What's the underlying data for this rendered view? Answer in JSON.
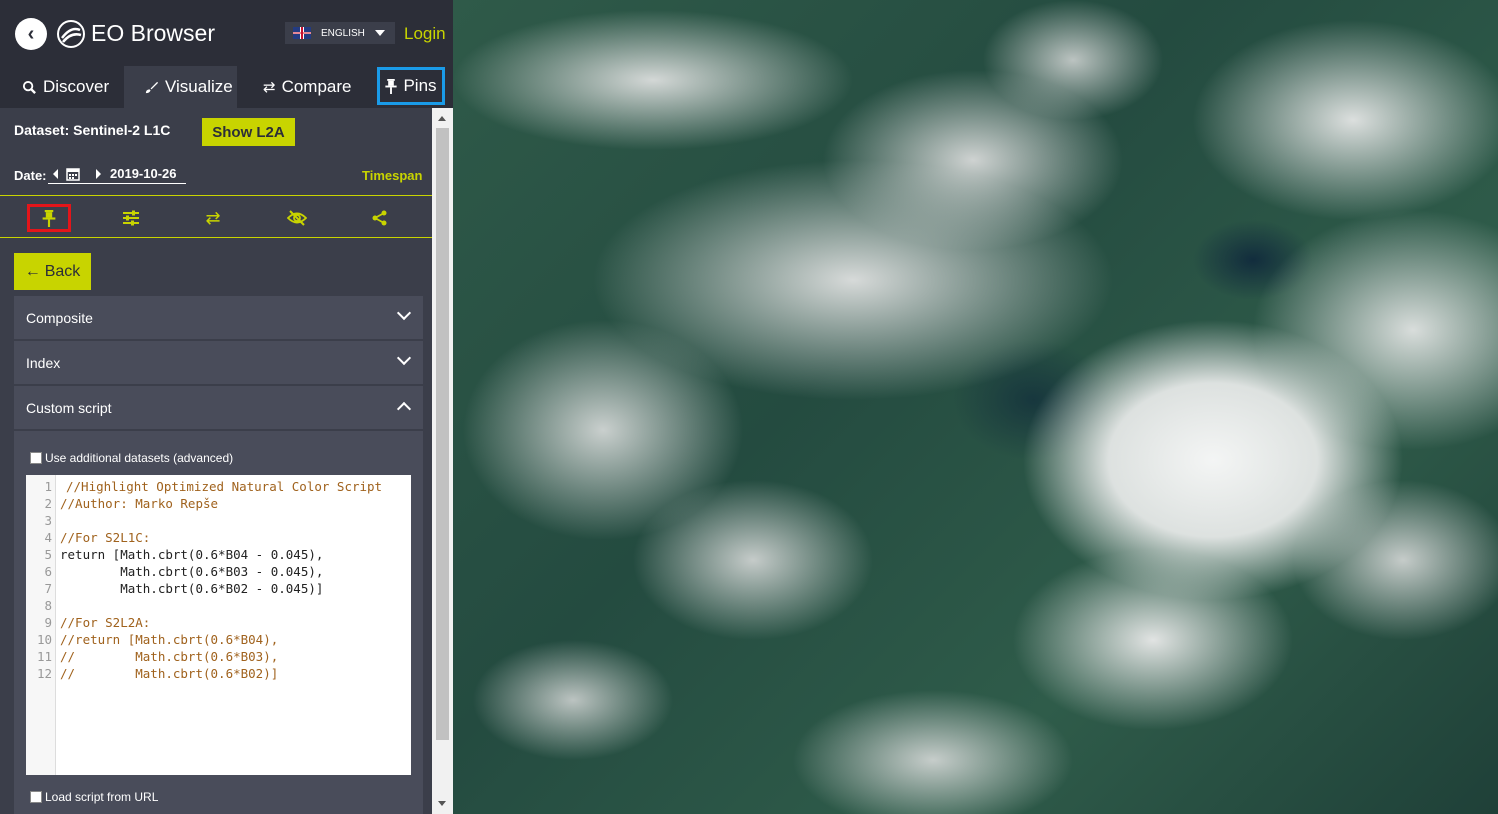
{
  "header": {
    "app_title": "EO Browser",
    "language": "ENGLISH",
    "login": "Login"
  },
  "tabs": [
    {
      "label": "Discover",
      "icon": "search-icon"
    },
    {
      "label": "Visualize",
      "icon": "brush-icon",
      "active": true
    },
    {
      "label": "Compare",
      "icon": "compare-arrows-icon"
    },
    {
      "label": "Pins",
      "icon": "pin-icon",
      "highlighted": true
    }
  ],
  "dataset": {
    "label": "Dataset:",
    "name": "Sentinel-2 L1C",
    "toggle_button": "Show L2A"
  },
  "date": {
    "label": "Date:",
    "value": "2019-10-26",
    "timespan": "Timespan"
  },
  "toolbar": [
    {
      "icon": "pin-icon",
      "highlighted": true
    },
    {
      "icon": "sliders-icon"
    },
    {
      "icon": "compare-arrows-icon"
    },
    {
      "icon": "eye-slash-icon"
    },
    {
      "icon": "share-icon"
    }
  ],
  "back_button": "Back",
  "accordion": {
    "composite": "Composite",
    "index": "Index",
    "custom_script": "Custom script"
  },
  "custom_script": {
    "additional_datasets": "Use additional datasets (advanced)",
    "load_from_url": "Load script from URL",
    "lines": [
      "//Highlight Optimized Natural Color Script",
      "//Author: Marko Repše",
      "",
      "//For S2L1C:",
      "return [Math.cbrt(0.6*B04 - 0.045),",
      "        Math.cbrt(0.6*B03 - 0.045),",
      "        Math.cbrt(0.6*B02 - 0.045)]",
      "",
      "//For S2L2A:",
      "//return [Math.cbrt(0.6*B04),",
      "//        Math.cbrt(0.6*B03),",
      "//        Math.cbrt(0.6*B02)]"
    ],
    "line_numbers": [
      "1",
      "2",
      "3",
      "4",
      "5",
      "6",
      "7",
      "8",
      "9",
      "10",
      "11",
      "12"
    ]
  },
  "colors": {
    "accent": "#c8d400",
    "panel": "#3b3e4a",
    "header": "#2c2e38",
    "pins_highlight": "#1a9be8",
    "pin_tool_highlight": "#e3151a"
  }
}
